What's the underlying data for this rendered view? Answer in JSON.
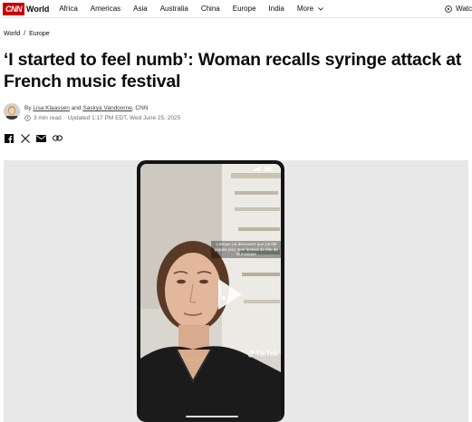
{
  "nav": {
    "logo_text": "CNN",
    "section": "World",
    "links": [
      "Africa",
      "Americas",
      "Asia",
      "Australia",
      "China",
      "Europe",
      "India"
    ],
    "more_label": "More",
    "watch_label": "Watc"
  },
  "breadcrumb": {
    "items": [
      "World",
      "Europe"
    ],
    "separator": "/"
  },
  "article": {
    "headline": "‘I started to feel numb’: Woman recalls syringe attack at French music festival",
    "byline_prefix": "By ",
    "author_1": "Lisa Klaassen",
    "byline_and": " and ",
    "author_2": "Saskya Vandoorne",
    "byline_suffix": ", CNN",
    "read_time": "3 min read",
    "updated": "· Updated 1:17 PM EDT, Wed June 25, 2025"
  },
  "share_icons": [
    "facebook-icon",
    "x-icon",
    "email-icon",
    "link-icon"
  ],
  "video": {
    "caption": "Lorsque j’ai découvert que j’ai été piquée (sic) mon festival de fête de la musique",
    "watermark": "TikTok"
  },
  "colors": {
    "brand": "#cc0000",
    "text": "#0c0c0c",
    "muted": "#6e6e6e",
    "video_bg": "#e8e8e8"
  }
}
